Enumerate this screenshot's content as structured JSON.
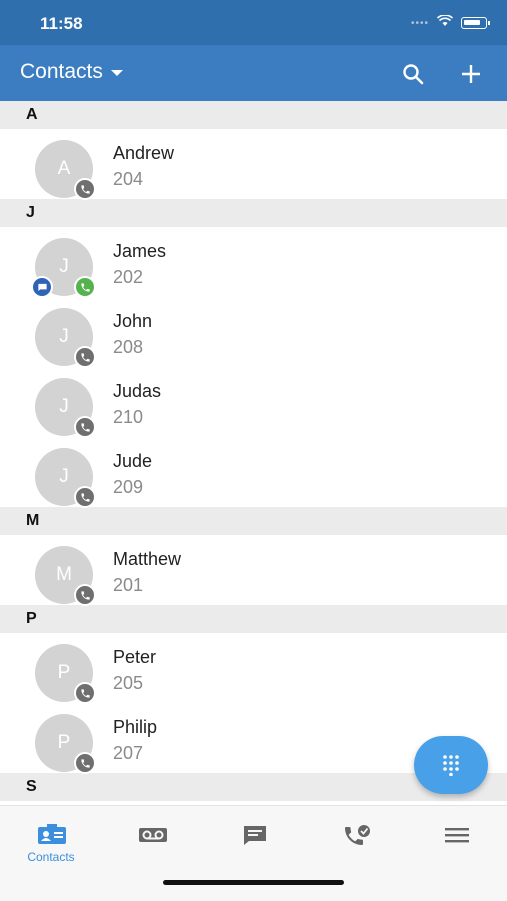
{
  "status_bar": {
    "time": "11:58"
  },
  "header": {
    "title": "Contacts"
  },
  "sections": [
    {
      "letter": "A",
      "contacts": [
        {
          "initial": "A",
          "name": "Andrew",
          "ext": "204"
        }
      ]
    },
    {
      "letter": "J",
      "contacts": [
        {
          "initial": "J",
          "name": "James",
          "ext": "202"
        },
        {
          "initial": "J",
          "name": "John",
          "ext": "208"
        },
        {
          "initial": "J",
          "name": "Judas",
          "ext": "210"
        },
        {
          "initial": "J",
          "name": "Jude",
          "ext": "209"
        }
      ]
    },
    {
      "letter": "M",
      "contacts": [
        {
          "initial": "M",
          "name": "Matthew",
          "ext": "201"
        }
      ]
    },
    {
      "letter": "P",
      "contacts": [
        {
          "initial": "P",
          "name": "Peter",
          "ext": "205"
        },
        {
          "initial": "P",
          "name": "Philip",
          "ext": "207"
        }
      ]
    },
    {
      "letter": "S",
      "contacts": []
    }
  ],
  "bottom_nav": {
    "contacts_label": "Contacts"
  },
  "colors": {
    "header": "#3b7dc0",
    "status_bar": "#2f6fae",
    "accent": "#48a0e8",
    "presence_green": "#55b34e",
    "chat_blue": "#2f63b8"
  }
}
